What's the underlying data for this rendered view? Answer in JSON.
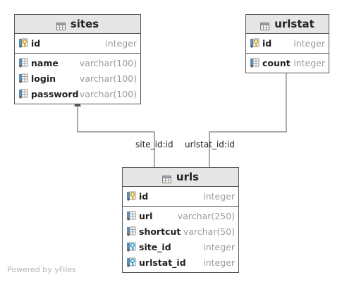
{
  "tables": {
    "sites": {
      "name": "sites",
      "pk": [
        {
          "name": "id",
          "type": "integer",
          "icon": "primary-key-icon"
        }
      ],
      "columns": [
        {
          "name": "name",
          "type": "varchar(100)",
          "icon": "column-icon"
        },
        {
          "name": "login",
          "type": "varchar(100)",
          "icon": "column-icon"
        },
        {
          "name": "password",
          "type": "varchar(100)",
          "icon": "column-icon"
        }
      ]
    },
    "urlstat": {
      "name": "urlstat",
      "pk": [
        {
          "name": "id",
          "type": "integer",
          "icon": "primary-key-icon"
        }
      ],
      "columns": [
        {
          "name": "count",
          "type": "integer",
          "icon": "column-icon"
        }
      ]
    },
    "urls": {
      "name": "urls",
      "pk": [
        {
          "name": "id",
          "type": "integer",
          "icon": "primary-key-icon"
        }
      ],
      "columns": [
        {
          "name": "url",
          "type": "varchar(250)",
          "icon": "column-icon"
        },
        {
          "name": "shortcut",
          "type": "varchar(50)",
          "icon": "column-icon"
        },
        {
          "name": "site_id",
          "type": "integer",
          "icon": "foreign-key-icon"
        },
        {
          "name": "urlstat_id",
          "type": "integer",
          "icon": "foreign-key-icon"
        }
      ]
    }
  },
  "relations": [
    {
      "label": "site_id:id",
      "from": "urls",
      "to": "sites"
    },
    {
      "label": "urlstat_id:id",
      "from": "urls",
      "to": "urlstat"
    }
  ],
  "watermark": "Powered by yFiles",
  "colors": {
    "header_bg": "#e6e6e6",
    "border": "#555555",
    "type_text": "#9a9a9a",
    "key_gold": "#d4a017",
    "fk_blue": "#2a9fd6"
  }
}
